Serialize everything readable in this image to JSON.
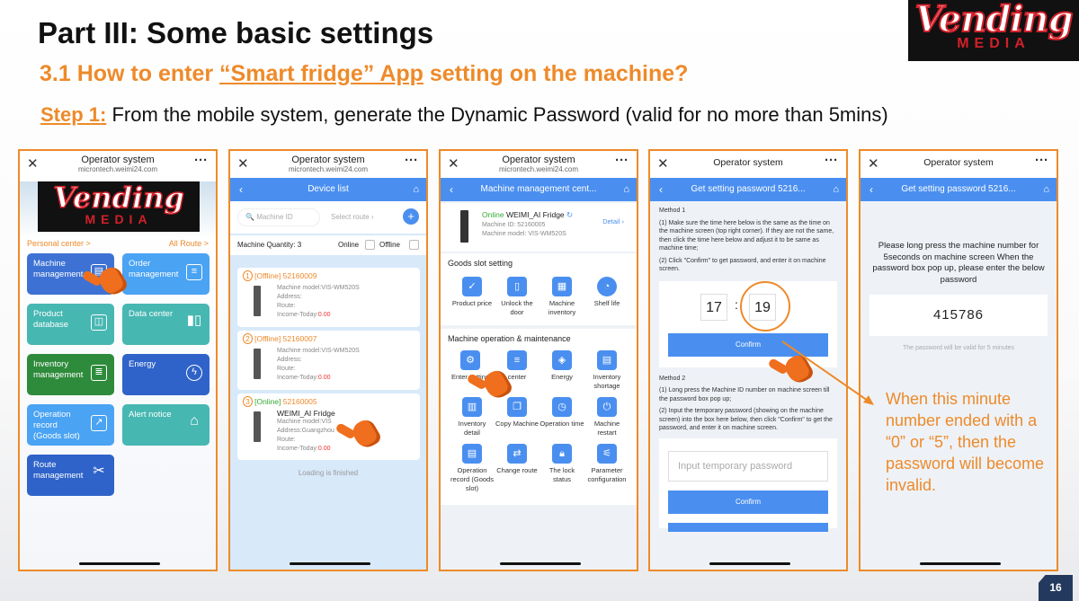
{
  "title": "Part III: Some basic settings",
  "subtitle_prefix": "3.1 How to enter ",
  "subtitle_link": "“Smart fridge” App",
  "subtitle_suffix": " setting on the machine?",
  "step_label": "Step 1:",
  "step_text": " From the mobile system, generate the Dynamic Password (valid for no more than 5mins)",
  "logo": {
    "line1": "Vending",
    "line2": "MEDIA"
  },
  "p1": {
    "title": "Operator system",
    "url": "microntech.weimi24.com",
    "personal": "Personal center >",
    "all_route": "All Route >",
    "tiles": [
      "Machine management",
      "Order management",
      "Product database",
      "Data center",
      "Inventory management",
      "Energy",
      "Operation record (Goods slot)",
      "Alert notice",
      "Route management"
    ]
  },
  "p2": {
    "title": "Operator system",
    "url": "microntech.weimi24.com",
    "nav": "Device list",
    "search_ph": "Machine ID",
    "route_ph": "Select route",
    "qty": "Machine Quantity: 3",
    "online": "Online",
    "offline": "Offline",
    "cards": [
      {
        "idx": "1",
        "state": "[Offline]",
        "id": "52160009",
        "model": "Machine model:VIS-WM520S",
        "addr": "Address:",
        "route": "Route:",
        "income_label": "Income-Today:",
        "income": "0.00"
      },
      {
        "idx": "2",
        "state": "[Offline]",
        "id": "52160007",
        "model": "Machine model:VIS-WM520S",
        "addr": "Address:",
        "route": "Route:",
        "income_label": "Income-Today:",
        "income": "0.00"
      },
      {
        "idx": "3",
        "state": "[Online]",
        "id": "52160005",
        "name": "WEIMI_AI Fridge",
        "model": "Machine model:VIS",
        "addr": "Address:Guangzhou",
        "route": "Route:",
        "income_label": "Income-Today:",
        "income": "0.00"
      }
    ],
    "loading": "Loading is finished"
  },
  "p3": {
    "title": "Operator system",
    "url": "microntech.weimi24.com",
    "nav": "Machine management cent...",
    "status": "Online",
    "name": "WEIMI_AI Fridge",
    "mid": "Machine ID: 52160005",
    "model": "Machine model: VIS-WM520S",
    "detail": "Detail",
    "sec1": "Goods slot setting",
    "g1": [
      "Product price",
      "Unlock the door",
      "Machine inventory",
      "Shelf life"
    ],
    "sec2": "Machine operation & maintenance",
    "g2": [
      "Enter setting",
      "center",
      "Energy",
      "Inventory shortage",
      "Inventory detail",
      "Copy Machine",
      "Operation time",
      "Machine restart",
      "Operation record (Goods slot)",
      "Change route",
      "The lock status",
      "Parameter configuration"
    ]
  },
  "p4": {
    "title": "Operator system",
    "nav": "Get setting password 5216...",
    "m1": "Method 1",
    "m1a": "(1) Make sure the time here below is the same as the time on the machine screen (top right corner). If they are not the same, then click the time here below and adjust it to be same as machine time;",
    "m1b": "(2) Click \"Confirm\" to get password, and enter it on machine screen.",
    "hh": "17",
    "mm": "19",
    "confirm": "Confirm",
    "m2": "Method 2",
    "m2a": "(1) Long press the Machine ID number on machine screen till the password box pop up;",
    "m2b": "(2) Input the temporary password (showing on the machine screen) into the box here below, then click \"Confirm\" to get the password, and enter it on machine screen.",
    "input_ph": "Input temporary password",
    "confirm2": "Confirm"
  },
  "p5": {
    "title": "Operator system",
    "nav": "Get setting password 5216...",
    "msg": "Please long press the machine number for 5seconds on machine screen When the password box pop up, please enter the below password",
    "pwd": "415786",
    "valid": "The password will be valid for 5 minutes"
  },
  "note": "When this minute number ended with a “0” or “5”, then the password will become invalid.",
  "page": "16",
  "colors": {
    "accent": "#ee8a2a",
    "app_blue": "#4a8ff0"
  }
}
